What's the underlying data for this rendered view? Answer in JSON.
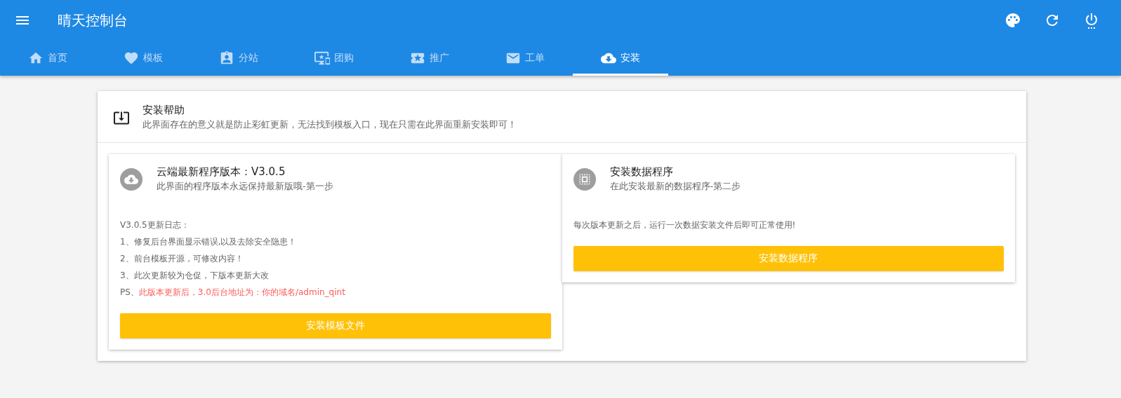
{
  "app_bar": {
    "title": "晴天控制台"
  },
  "tabs": [
    {
      "label": "首页",
      "selected": false
    },
    {
      "label": "模板",
      "selected": false
    },
    {
      "label": "分站",
      "selected": false
    },
    {
      "label": "团购",
      "selected": false
    },
    {
      "label": "推广",
      "selected": false
    },
    {
      "label": "工单",
      "selected": false
    },
    {
      "label": "安装",
      "selected": true
    }
  ],
  "help": {
    "title": "安装帮助",
    "subtitle": "此界面存在的意义就是防止彩虹更新，无法找到模板入口，现在只需在此界面重新安装即可！"
  },
  "cards": [
    {
      "title": "云端最新程序版本：V3.0.5",
      "subtitle": "此界面的程序版本永远保持最新版哦-第一步",
      "lines": [
        {
          "text": "V3.0.5更新日志："
        },
        {
          "text": "1、修复后台界面显示错误,以及去除安全隐患！"
        },
        {
          "text": "2、前台模板开源，可修改内容！"
        },
        {
          "text": "3、此次更新较为仓促，下版本更新大改"
        },
        {
          "text": "PS、",
          "highlight": "此版本更新后，3.0后台地址为：你的域名/admin_qint"
        }
      ],
      "button": "安装模板文件"
    },
    {
      "title": "安装数据程序",
      "subtitle": "在此安装最新的数据程序-第二步",
      "lines": [
        {
          "text": "每次版本更新之后，运行一次数据安装文件后即可正常使用!"
        }
      ],
      "button": "安装数据程序"
    }
  ]
}
